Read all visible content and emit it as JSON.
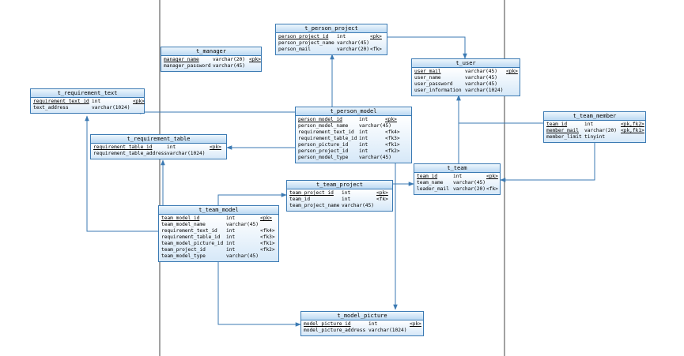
{
  "tables": {
    "t_person_project": {
      "title": "t_person_project",
      "rows": [
        {
          "name": "person_project_id",
          "type": "int",
          "key": "<pk>"
        },
        {
          "name": "person_project_name",
          "type": "varchar(45)",
          "key": ""
        },
        {
          "name": "person_mail",
          "type": "varchar(20)",
          "key": "<fk>"
        }
      ]
    },
    "t_manager": {
      "title": "t_manager",
      "rows": [
        {
          "name": "manager_name",
          "type": "varchar(20)",
          "key": "<pk>"
        },
        {
          "name": "manager_password",
          "type": "varchar(45)",
          "key": ""
        }
      ]
    },
    "t_user": {
      "title": "t_user",
      "rows": [
        {
          "name": "user_mail",
          "type": "varchar(45)",
          "key": "<pk>"
        },
        {
          "name": "user_name",
          "type": "varchar(45)",
          "key": ""
        },
        {
          "name": "user_password",
          "type": "varchar(45)",
          "key": ""
        },
        {
          "name": "user_information",
          "type": "varchar(1024)",
          "key": ""
        }
      ]
    },
    "t_requirement_text": {
      "title": "t_requirement_text",
      "rows": [
        {
          "name": "requirement_text_id",
          "type": "int",
          "key": "<pk>"
        },
        {
          "name": "text_address",
          "type": "varchar(1024)",
          "key": ""
        }
      ]
    },
    "t_person_model": {
      "title": "t_person_model",
      "rows": [
        {
          "name": "person_model_id",
          "type": "int",
          "key": "<pk>"
        },
        {
          "name": "person_model_name",
          "type": "varchar(45)",
          "key": ""
        },
        {
          "name": "requirement_text_id",
          "type": "int",
          "key": "<fk4>"
        },
        {
          "name": "requirement_table_id",
          "type": "int",
          "key": "<fk3>"
        },
        {
          "name": "person_picture_id",
          "type": "int",
          "key": "<fk1>"
        },
        {
          "name": "person_project_id",
          "type": "int",
          "key": "<fk2>"
        },
        {
          "name": "person_model_type",
          "type": "varchar(45)",
          "key": ""
        }
      ]
    },
    "t_team_member": {
      "title": "t_team_member",
      "rows": [
        {
          "name": "team_id",
          "type": "int",
          "key": "<pk,fk2>"
        },
        {
          "name": "member_mail",
          "type": "varchar(20)",
          "key": "<pk,fk1>"
        },
        {
          "name": "member_limit",
          "type": "tinyint",
          "key": ""
        }
      ]
    },
    "t_requirement_table": {
      "title": "t_requirement_table",
      "rows": [
        {
          "name": "requirement_table_id",
          "type": "int",
          "key": "<pk>"
        },
        {
          "name": "requirement_table_address",
          "type": "varchar(1024)",
          "key": ""
        }
      ]
    },
    "t_team": {
      "title": "t_team",
      "rows": [
        {
          "name": "team_id",
          "type": "int",
          "key": "<pk>"
        },
        {
          "name": "team_name",
          "type": "varchar(45)",
          "key": ""
        },
        {
          "name": "leader_mail",
          "type": "varchar(20)",
          "key": "<fk>"
        }
      ]
    },
    "t_team_project": {
      "title": "t_team_project",
      "rows": [
        {
          "name": "team_project_id",
          "type": "int",
          "key": "<pk>"
        },
        {
          "name": "team_id",
          "type": "int",
          "key": "<fk>"
        },
        {
          "name": "team_project_name",
          "type": "varchar(45)",
          "key": ""
        }
      ]
    },
    "t_team_model": {
      "title": "t_team_model",
      "rows": [
        {
          "name": "team_model_id",
          "type": "int",
          "key": "<pk>"
        },
        {
          "name": "team_model_name",
          "type": "varchar(45)",
          "key": ""
        },
        {
          "name": "requirement_text_id",
          "type": "int",
          "key": "<fk4>"
        },
        {
          "name": "requirement_table_id",
          "type": "int",
          "key": "<fk3>"
        },
        {
          "name": "team_model_picture_id",
          "type": "int",
          "key": "<fk1>"
        },
        {
          "name": "team_project_id",
          "type": "int",
          "key": "<fk2>"
        },
        {
          "name": "team_model_type",
          "type": "varchar(45)",
          "key": ""
        }
      ]
    },
    "t_model_picture": {
      "title": "t_model_picture",
      "rows": [
        {
          "name": "model_picture_id",
          "type": "int",
          "key": "<pk>"
        },
        {
          "name": "model_picture_address",
          "type": "varchar(1024)",
          "key": ""
        }
      ]
    }
  },
  "colors": {
    "line": "#3b7ab3",
    "border": "#3b7ab3",
    "divider": "#444444"
  }
}
